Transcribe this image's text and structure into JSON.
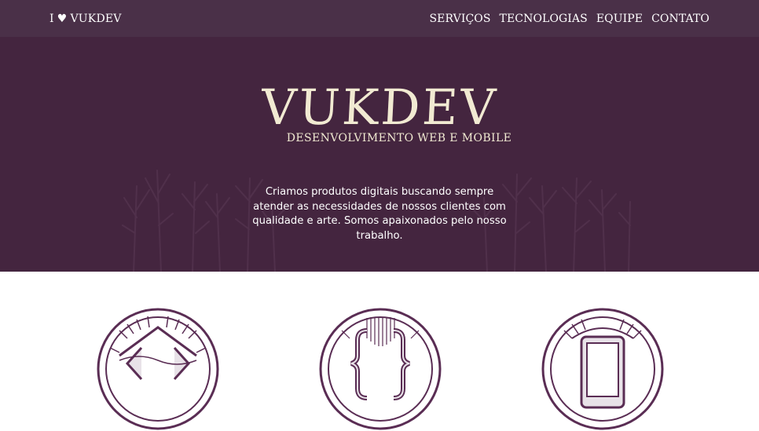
{
  "navbar": {
    "brand": {
      "before": "I",
      "heart": "♥",
      "after": "VUKDEV"
    },
    "items": [
      {
        "label": "SERVIÇOS"
      },
      {
        "label": "TECNOLOGIAS"
      },
      {
        "label": "EQUIPE"
      },
      {
        "label": "CONTATO"
      }
    ]
  },
  "hero": {
    "logo_title": "VUKDEV",
    "logo_subtitle": "DESENVOLVIMENTO WEB E MOBILE",
    "description": "Criamos produtos digitais buscando sempre atender as necessidades de nossos clientes com qualidade e arte. Somos apaixonados pelo nosso trabalho."
  },
  "services": {
    "icons": [
      "web-code-icon",
      "curly-braces-icon",
      "mobile-phone-icon"
    ]
  },
  "colors": {
    "navbar": "#4a3048",
    "hero": "#44253f",
    "logo": "#f1ead2",
    "icon_stroke": "#5a2d54"
  }
}
